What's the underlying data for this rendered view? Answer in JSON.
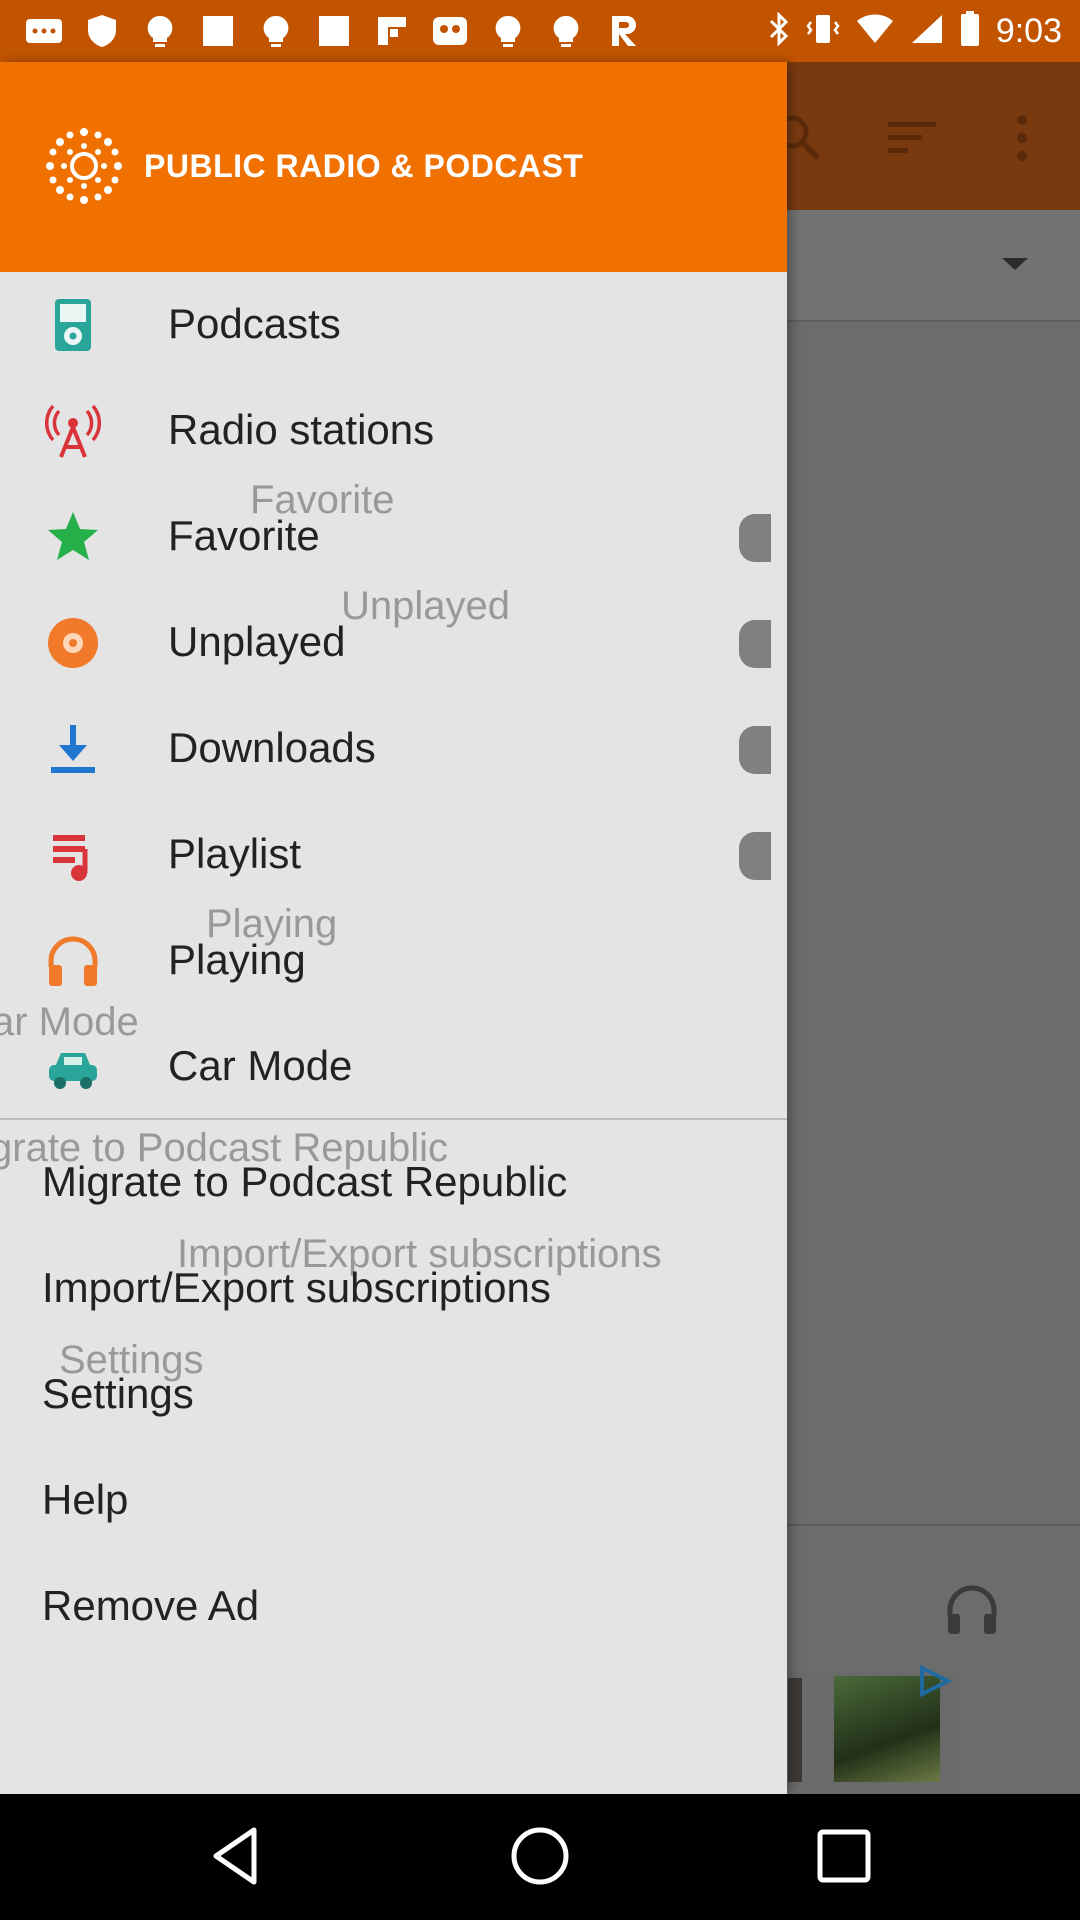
{
  "status_bar": {
    "time": "9:03",
    "icons_left": [
      "message-icon",
      "shield-icon",
      "lightbulb-icon",
      "square-icon",
      "lightbulb-icon",
      "square-icon",
      "flipboard-icon",
      "photo-icon",
      "lightbulb-icon",
      "lightbulb-icon",
      "r-app-icon"
    ],
    "icons_right": [
      "bluetooth-icon",
      "vibrate-icon",
      "wifi-icon",
      "signal-icon",
      "battery-icon"
    ]
  },
  "drawer": {
    "title": "PUBLIC RADIO & PODCAST",
    "items": [
      {
        "label": "Podcasts",
        "icon": "ipod-icon"
      },
      {
        "label": "Radio stations",
        "icon": "radio-tower-icon"
      },
      {
        "label": "Favorite",
        "icon": "star-icon",
        "ghost": "Favorite"
      },
      {
        "label": "Unplayed",
        "icon": "unplayed-disc-icon",
        "ghost": "Unplayed"
      },
      {
        "label": "Downloads",
        "icon": "download-icon"
      },
      {
        "label": "Playlist",
        "icon": "playlist-icon"
      },
      {
        "label": "Playing",
        "icon": "headphones-icon",
        "ghost": "Playing"
      },
      {
        "label": "Car Mode",
        "icon": "car-icon",
        "ghost": "ar Mode"
      }
    ],
    "secondary": [
      {
        "label": "Migrate to Podcast Republic",
        "ghost": "grate to Podcast Republic"
      },
      {
        "label": "Import/Export subscriptions",
        "ghost": "Import/Export subscriptions"
      },
      {
        "label": "Settings",
        "ghost": "Settings"
      },
      {
        "label": "Help"
      },
      {
        "label": "Remove Ad"
      }
    ]
  },
  "colors": {
    "header_orange": "#f07000",
    "status_bar": "#c25400",
    "drawer_bg": "#e4e4e4"
  }
}
